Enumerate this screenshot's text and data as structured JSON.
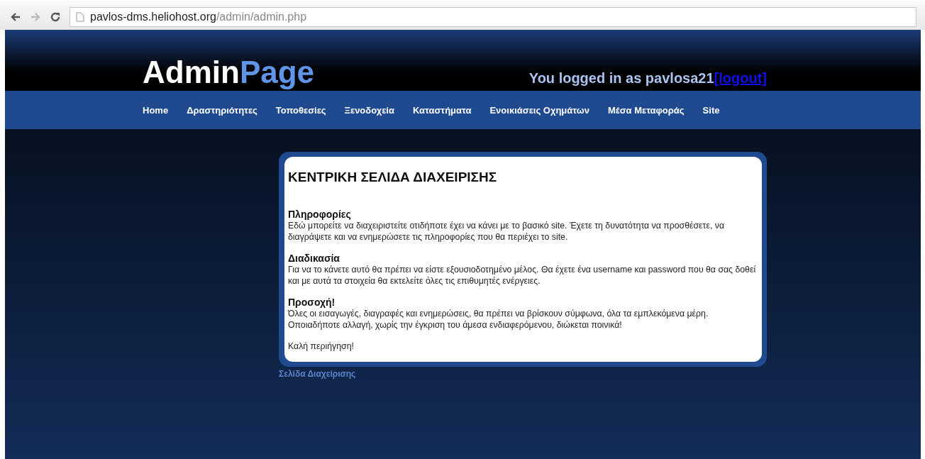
{
  "browser": {
    "back": {
      "disabled": false
    },
    "forward": {
      "disabled": true
    },
    "url_host": "pavlos-dms.heliohost.org",
    "url_path": "/admin/admin.php"
  },
  "header": {
    "logo_main": "Admin",
    "logo_accent": "Page",
    "login_text": "You logged in as pavlosa21",
    "logout_link": "[logout]"
  },
  "nav": [
    {
      "label": "Home"
    },
    {
      "label": "Δραστηριότητες"
    },
    {
      "label": "Τοποθεσίες"
    },
    {
      "label": "Ξενοδοχεία"
    },
    {
      "label": "Καταστήματα"
    },
    {
      "label": "Ενοικιάσεις Οχημάτων"
    },
    {
      "label": "Μέσα Μεταφοράς"
    },
    {
      "label": "Site"
    }
  ],
  "content": {
    "title": "ΚΕΝΤΡΙΚΗ ΣΕΛΙΔΑ ΔΙΑΧΕΙΡΙΣΗΣ",
    "sections": [
      {
        "heading": "Πληροφορίες",
        "text": "Εδώ μπορείτε να διαχειριστείτε οτιδήποτε έχει να κάνει με το βασικό site. Έχετε τη δυνατότητα να προσθέσετε, να διαγράψετε και να ενημερώσετε τις πληροφορίες που θα περιέχει το site."
      },
      {
        "heading": "Διαδικασία",
        "text": "Για να το κάνετε αυτό θα πρέπει να είστε εξουσιοδοτημένο μέλος. Θα έχετε ένα username και password που θα σας δοθεί και με αυτά τα στοιχεία θα εκτελείτε όλες τις επιθυμητές ενέργειες."
      },
      {
        "heading": "Προσοχή!",
        "text": "Όλες οι εισαγωγές, διαγραφές και ενημερώσεις, θα πρέπει να βρίσκουν σύμφωνα, όλα τα εμπλεκόμενα μέρη. Οποιαδήποτε αλλαγή, χωρίς την έγκριση του άμεσα ενδιαφερόμενου, διώκεται ποινικά!"
      }
    ],
    "closing": "Καλή περιήγηση!"
  },
  "footer_link": "Σελίδα Διαχείρισης"
}
